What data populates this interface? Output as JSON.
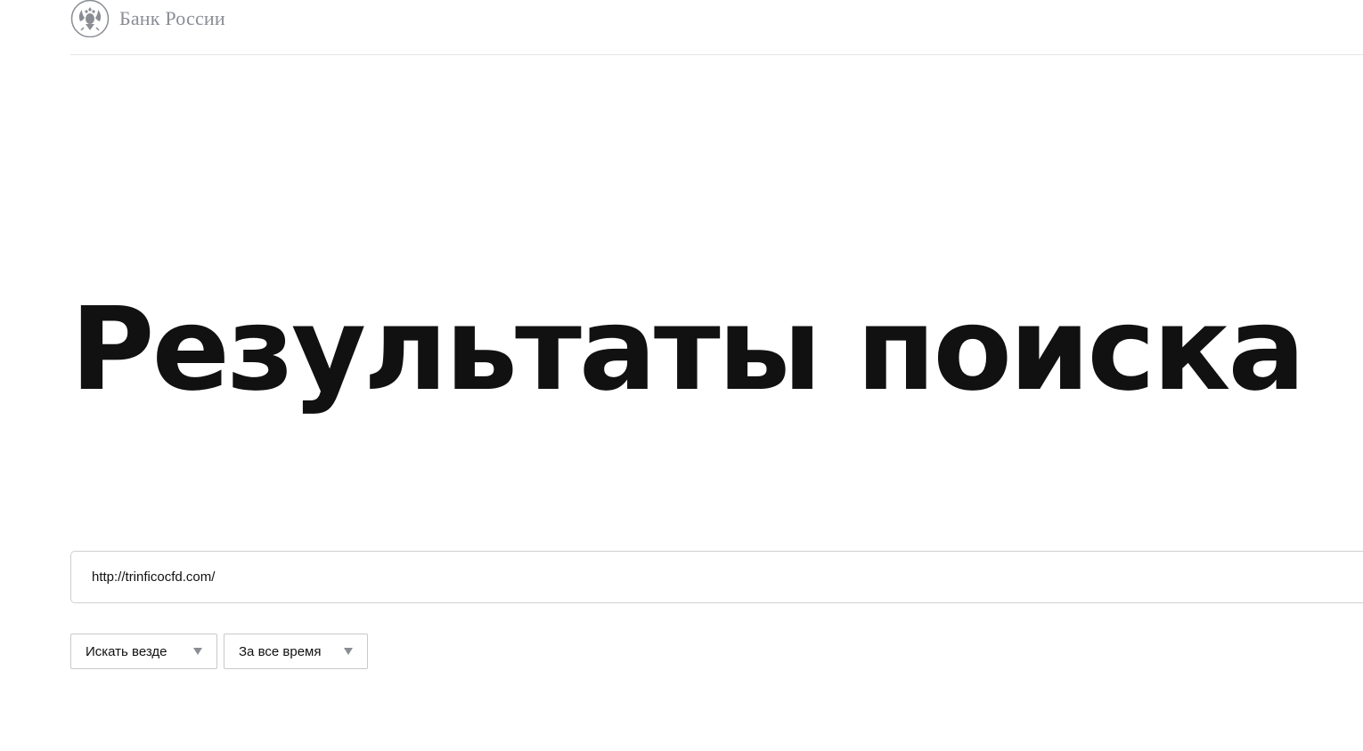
{
  "header": {
    "logo_text": "Банк России",
    "logo_icon": "double-headed-eagle-emblem-icon"
  },
  "main": {
    "title": "Результаты поиска",
    "search": {
      "value": "http://trinficocfd.com/"
    },
    "filters": {
      "where": {
        "selected": "Искать везде"
      },
      "when": {
        "selected": "За все время"
      }
    }
  },
  "colors": {
    "logo_gray": "#8a8d94",
    "text": "#111111",
    "border": "#cfcfd3"
  }
}
